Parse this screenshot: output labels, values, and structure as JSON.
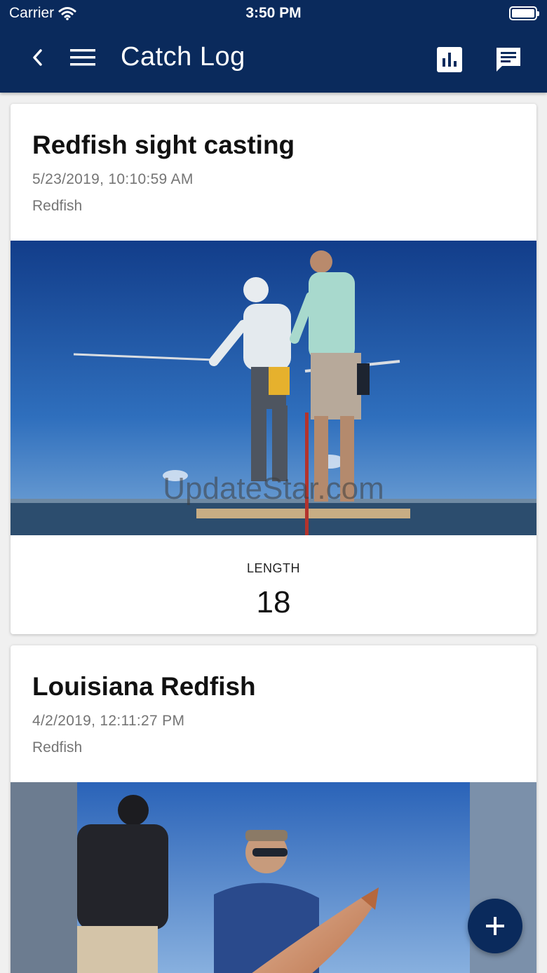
{
  "status_bar": {
    "carrier": "Carrier",
    "time": "3:50 PM"
  },
  "nav": {
    "title": "Catch Log",
    "icons": [
      "back-icon",
      "menu-icon",
      "bar-chart-icon",
      "chat-icon"
    ]
  },
  "catches": [
    {
      "title": "Redfish sight casting",
      "date": "5/23/2019, 10:10:59 AM",
      "species": "Redfish",
      "photo": "two-anglers-on-boat-photo",
      "metric_label": "LENGTH",
      "metric_value": "18"
    },
    {
      "title": "Louisiana Redfish",
      "date": "4/2/2019, 12:11:27 PM",
      "species": "Redfish",
      "photo": "angler-holding-redfish-photo"
    }
  ],
  "fab": {
    "icon": "plus-icon"
  },
  "watermark": "UpdateStar.com",
  "colors": {
    "header": "#0a2a5c",
    "fab": "#0a2a5c",
    "subtext": "#757575",
    "background": "#f0f0f0"
  }
}
